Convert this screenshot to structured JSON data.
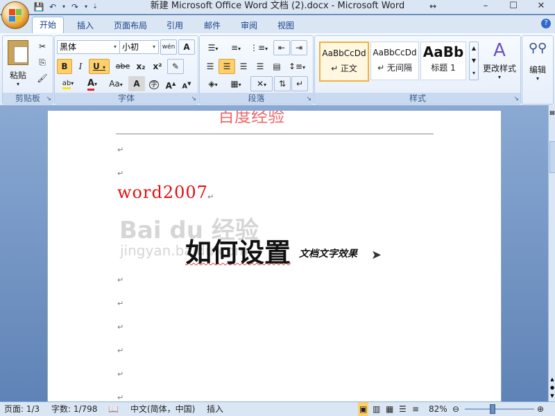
{
  "window": {
    "title": "新建 Microsoft Office Word 文档 (2).docx - Microsoft Word",
    "min": "–",
    "max": "☐",
    "close": "✕"
  },
  "tabs": [
    "开始",
    "插入",
    "页面布局",
    "引用",
    "邮件",
    "审阅",
    "视图"
  ],
  "ribbon": {
    "clipboard": {
      "label": "剪贴板",
      "paste": "粘贴"
    },
    "font": {
      "label": "字体",
      "font_name": "黑体",
      "font_size": "小初",
      "bold": "B",
      "italic": "I",
      "underline": "U",
      "strike": "abe",
      "sub": "x₂",
      "sup": "x²",
      "aa": "Aa",
      "grow": "A",
      "shrink": "A",
      "char_a": "A",
      "circle": "字",
      "wen": "wén"
    },
    "paragraph": {
      "label": "段落"
    },
    "styles": {
      "label": "样式",
      "cards": [
        {
          "preview": "AaBbCcDd",
          "name": "↵ 正文",
          "selected": true
        },
        {
          "preview": "AaBbCcDd",
          "name": "↵ 无间隔",
          "selected": false
        },
        {
          "preview": "AaBb",
          "name": "标题 1",
          "selected": false
        }
      ],
      "change": "更改样式"
    },
    "editing": {
      "label": "编辑"
    }
  },
  "document": {
    "header_text": "百度经验",
    "line_word": "word2007",
    "main_title": "如何设置",
    "subtitle": "文档文字效果",
    "para_mark": "↵",
    "watermark": "Bai du 经验",
    "watermark_url": "jingyan.baidu.com"
  },
  "status": {
    "page": "页面: 1/3",
    "words": "字数: 1/798",
    "lang": "中文(简体，中国)",
    "mode": "插入",
    "zoom": "82%"
  },
  "colors": {
    "accent": "#15428b",
    "highlight": "#ffd06a"
  }
}
